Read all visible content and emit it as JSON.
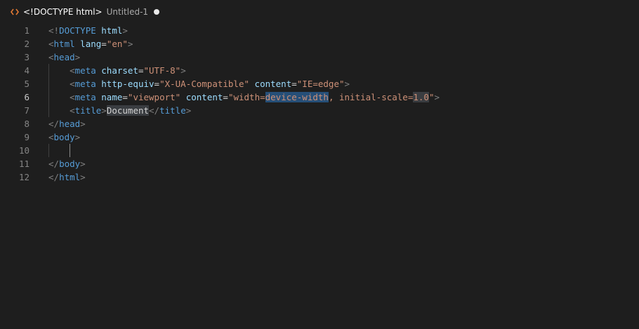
{
  "breadcrumb": {
    "icon": "html-file-icon",
    "symbol": "<!DOCTYPE html>",
    "file": "Untitled-1",
    "modified_indicator": "unsaved-dot"
  },
  "editor": {
    "active_line": 6,
    "lines": [
      {
        "n": "1",
        "tokens": [
          {
            "t": "<!",
            "c": "punct"
          },
          {
            "t": "DOCTYPE",
            "c": "tag"
          },
          {
            "t": " ",
            "c": "text"
          },
          {
            "t": "html",
            "c": "attr"
          },
          {
            "t": ">",
            "c": "punct"
          }
        ]
      },
      {
        "n": "2",
        "tokens": [
          {
            "t": "<",
            "c": "punct"
          },
          {
            "t": "html",
            "c": "tag"
          },
          {
            "t": " ",
            "c": "text"
          },
          {
            "t": "lang",
            "c": "attr"
          },
          {
            "t": "=",
            "c": "text"
          },
          {
            "t": "\"en\"",
            "c": "str"
          },
          {
            "t": ">",
            "c": "punct"
          }
        ]
      },
      {
        "n": "3",
        "tokens": [
          {
            "t": "<",
            "c": "punct"
          },
          {
            "t": "head",
            "c": "tag"
          },
          {
            "t": ">",
            "c": "punct"
          }
        ]
      },
      {
        "n": "4",
        "tokens": [
          {
            "t": "    ",
            "c": "text"
          },
          {
            "t": "<",
            "c": "punct"
          },
          {
            "t": "meta",
            "c": "tag"
          },
          {
            "t": " ",
            "c": "text"
          },
          {
            "t": "charset",
            "c": "attr"
          },
          {
            "t": "=",
            "c": "text"
          },
          {
            "t": "\"UTF-8\"",
            "c": "str"
          },
          {
            "t": ">",
            "c": "punct"
          }
        ]
      },
      {
        "n": "5",
        "tokens": [
          {
            "t": "    ",
            "c": "text"
          },
          {
            "t": "<",
            "c": "punct"
          },
          {
            "t": "meta",
            "c": "tag"
          },
          {
            "t": " ",
            "c": "text"
          },
          {
            "t": "http-equiv",
            "c": "attr"
          },
          {
            "t": "=",
            "c": "text"
          },
          {
            "t": "\"X-UA-Compatible\"",
            "c": "str"
          },
          {
            "t": " ",
            "c": "text"
          },
          {
            "t": "content",
            "c": "attr"
          },
          {
            "t": "=",
            "c": "text"
          },
          {
            "t": "\"IE=edge\"",
            "c": "str"
          },
          {
            "t": ">",
            "c": "punct"
          }
        ]
      },
      {
        "n": "6",
        "tokens": [
          {
            "t": "    ",
            "c": "text"
          },
          {
            "t": "<",
            "c": "punct"
          },
          {
            "t": "meta",
            "c": "tag"
          },
          {
            "t": " ",
            "c": "text"
          },
          {
            "t": "name",
            "c": "attr"
          },
          {
            "t": "=",
            "c": "text"
          },
          {
            "t": "\"viewport\"",
            "c": "str"
          },
          {
            "t": " ",
            "c": "text"
          },
          {
            "t": "content",
            "c": "attr"
          },
          {
            "t": "=",
            "c": "text"
          },
          {
            "t": "\"width=",
            "c": "str"
          },
          {
            "t": "device-width",
            "c": "sel"
          },
          {
            "t": ", initial-scale=",
            "c": "str"
          },
          {
            "t": "1.0",
            "c": "hl"
          },
          {
            "t": "\"",
            "c": "str"
          },
          {
            "t": ">",
            "c": "punct"
          }
        ]
      },
      {
        "n": "7",
        "tokens": [
          {
            "t": "    ",
            "c": "text"
          },
          {
            "t": "<",
            "c": "punct"
          },
          {
            "t": "title",
            "c": "tag"
          },
          {
            "t": ">",
            "c": "punct"
          },
          {
            "t": "Document",
            "c": "hltext"
          },
          {
            "t": "</",
            "c": "punct"
          },
          {
            "t": "title",
            "c": "tag"
          },
          {
            "t": ">",
            "c": "punct"
          }
        ]
      },
      {
        "n": "8",
        "tokens": [
          {
            "t": "</",
            "c": "punct"
          },
          {
            "t": "head",
            "c": "tag"
          },
          {
            "t": ">",
            "c": "punct"
          }
        ]
      },
      {
        "n": "9",
        "tokens": [
          {
            "t": "<",
            "c": "punct"
          },
          {
            "t": "body",
            "c": "tag"
          },
          {
            "t": ">",
            "c": "punct"
          }
        ]
      },
      {
        "n": "10",
        "tokens": []
      },
      {
        "n": "11",
        "tokens": [
          {
            "t": "</",
            "c": "punct"
          },
          {
            "t": "body",
            "c": "tag"
          },
          {
            "t": ">",
            "c": "punct"
          }
        ]
      },
      {
        "n": "12",
        "tokens": [
          {
            "t": "</",
            "c": "punct"
          },
          {
            "t": "html",
            "c": "tag"
          },
          {
            "t": ">",
            "c": "punct"
          }
        ]
      }
    ]
  },
  "colors": {
    "background": "#1e1e1e",
    "tag": "#569cd6",
    "attribute": "#9cdcfe",
    "string": "#ce9178",
    "punctuation": "#808080",
    "line_number": "#858585",
    "selection": "#264f78"
  }
}
